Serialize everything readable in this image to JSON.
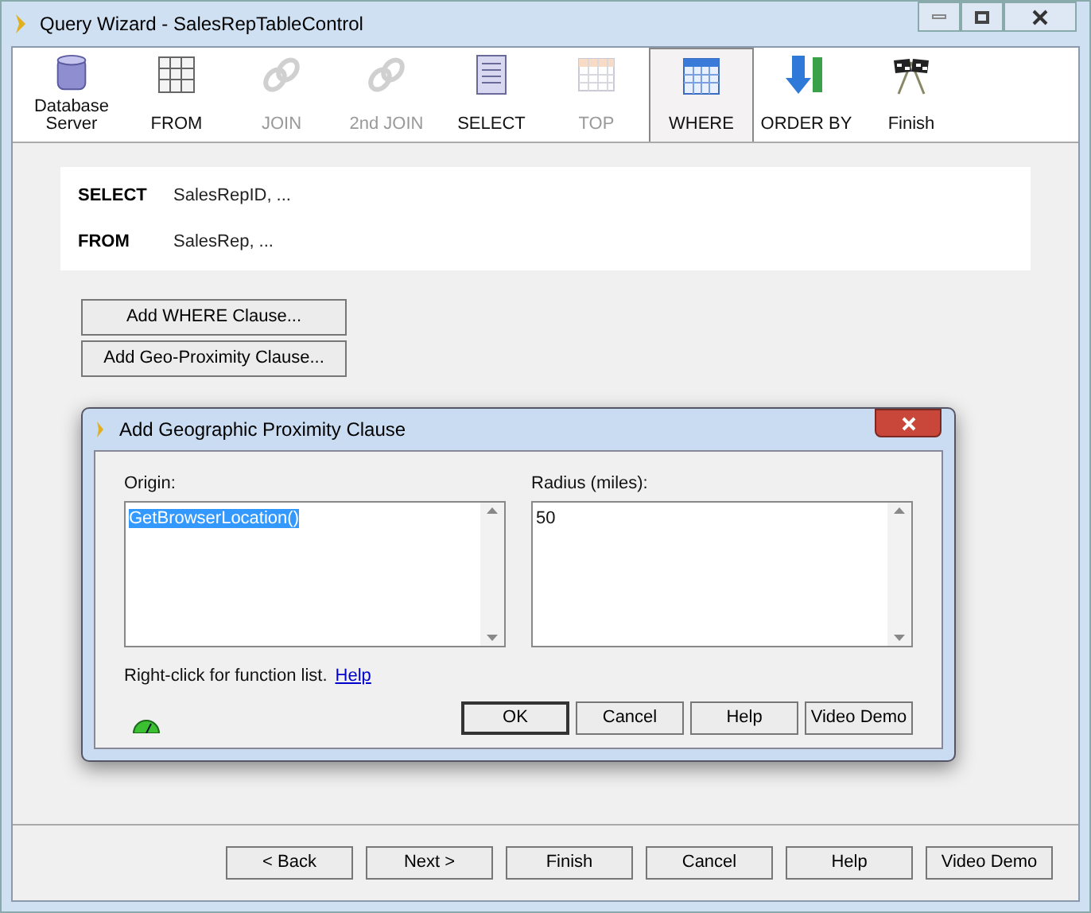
{
  "window": {
    "title": "Query Wizard - SalesRepTableControl"
  },
  "steps": [
    {
      "label": "Database Server",
      "kind": "database",
      "disabled": false,
      "selected": false
    },
    {
      "label": "FROM",
      "kind": "grid",
      "disabled": false,
      "selected": false
    },
    {
      "label": "JOIN",
      "kind": "chain",
      "disabled": true,
      "selected": false
    },
    {
      "label": "2nd JOIN",
      "kind": "chain",
      "disabled": true,
      "selected": false
    },
    {
      "label": "SELECT",
      "kind": "list",
      "disabled": false,
      "selected": false
    },
    {
      "label": "TOP",
      "kind": "table",
      "disabled": true,
      "selected": false
    },
    {
      "label": "WHERE",
      "kind": "calendar",
      "disabled": false,
      "selected": true
    },
    {
      "label": "ORDER BY",
      "kind": "sort",
      "disabled": false,
      "selected": false
    },
    {
      "label": "Finish",
      "kind": "flags",
      "disabled": false,
      "selected": false
    }
  ],
  "summary": [
    {
      "keyword": "SELECT",
      "value": "SalesRepID, ..."
    },
    {
      "keyword": "FROM",
      "value": "SalesRep, ..."
    }
  ],
  "clause_buttons": [
    "Add WHERE Clause...",
    "Add Geo-Proximity Clause..."
  ],
  "dialog": {
    "title": "Add Geographic Proximity Clause",
    "origin": {
      "label": "Origin:",
      "value": "GetBrowserLocation()",
      "highlighted": true
    },
    "radius": {
      "label": "Radius (miles):",
      "value": "50",
      "highlighted": false
    },
    "hint": "Right-click for function list.",
    "help_link": "Help",
    "buttons": [
      {
        "label": "OK",
        "default": true
      },
      {
        "label": "Cancel",
        "default": false
      },
      {
        "label": "Help",
        "default": false
      },
      {
        "label": "Video Demo",
        "default": false
      }
    ]
  },
  "footer_buttons": [
    "< Back",
    "Next >",
    "Finish",
    "Cancel",
    "Help",
    "Video Demo"
  ]
}
